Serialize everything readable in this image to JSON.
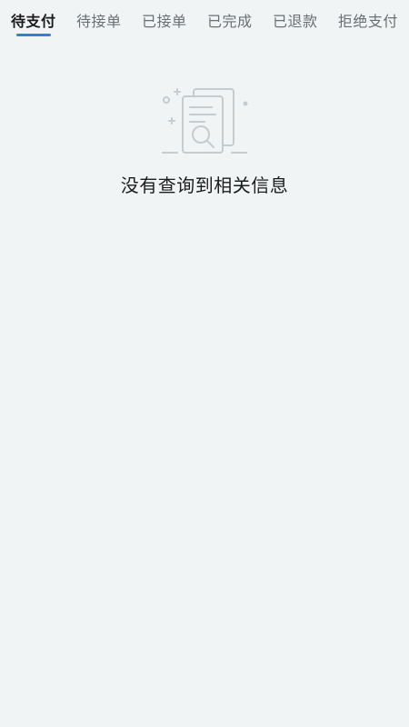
{
  "tabs": [
    {
      "label": "待支付",
      "active": true
    },
    {
      "label": "待接单",
      "active": false
    },
    {
      "label": "已接单",
      "active": false
    },
    {
      "label": "已完成",
      "active": false
    },
    {
      "label": "已退款",
      "active": false
    },
    {
      "label": "拒绝支付",
      "active": false
    }
  ],
  "empty_state": {
    "icon": "document-search-icon",
    "message": "没有查询到相关信息"
  },
  "colors": {
    "background": "#f1f4f5",
    "active_indicator": "#3a7bd5",
    "active_text": "#1a1a1a",
    "inactive_text": "#6a6f73",
    "illustration_stroke": "#c6cbcf"
  }
}
